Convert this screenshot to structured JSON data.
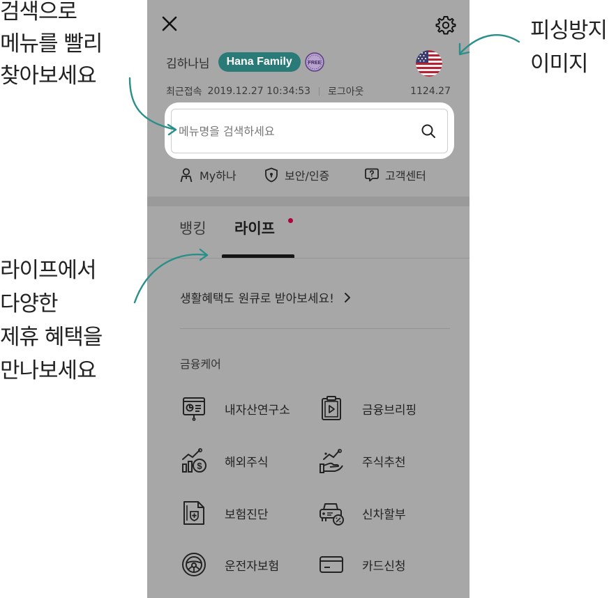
{
  "annotations": {
    "search": [
      "검색으로",
      "메뉴를 빨리",
      "찾아보세요"
    ],
    "life": [
      "라이프에서",
      "다양한",
      "제휴 혜택을",
      "만나보세요"
    ],
    "phishing": [
      "피싱방지",
      "이미지"
    ]
  },
  "header": {
    "user_name": "김하나님",
    "family_badge": "Hana Family",
    "free_badge": "FREE",
    "last_login_label": "최근접속",
    "last_login_time": "2019.12.27 10:34:53",
    "logout": "로그아웃",
    "points": "1124.27"
  },
  "search": {
    "placeholder": "메뉴명을 검색하세요"
  },
  "quick_links": [
    {
      "label": "My하나",
      "icon": "person-icon"
    },
    {
      "label": "보안/인증",
      "icon": "shield-icon"
    },
    {
      "label": "고객센터",
      "icon": "help-chat-icon"
    }
  ],
  "tabs": [
    {
      "label": "뱅킹",
      "active": false
    },
    {
      "label": "라이프",
      "active": true
    }
  ],
  "promo": {
    "text": "생활혜택도 원큐로 받아보세요!"
  },
  "section": {
    "title": "금융케어"
  },
  "menu": [
    {
      "label": "내자산연구소",
      "icon": "asset-report-icon"
    },
    {
      "label": "금융브리핑",
      "icon": "briefing-clipboard-icon"
    },
    {
      "label": "해외주식",
      "icon": "foreign-stock-icon"
    },
    {
      "label": "주식추천",
      "icon": "stock-recommend-icon"
    },
    {
      "label": "보험진단",
      "icon": "insurance-doc-icon"
    },
    {
      "label": "신차할부",
      "icon": "car-installment-icon"
    },
    {
      "label": "운전자보험",
      "icon": "steering-wheel-icon"
    },
    {
      "label": "카드신청",
      "icon": "credit-card-icon"
    }
  ],
  "colors": {
    "accent": "#2a7a77",
    "dot": "#b0003a",
    "overlay": "#a7a7a7"
  }
}
